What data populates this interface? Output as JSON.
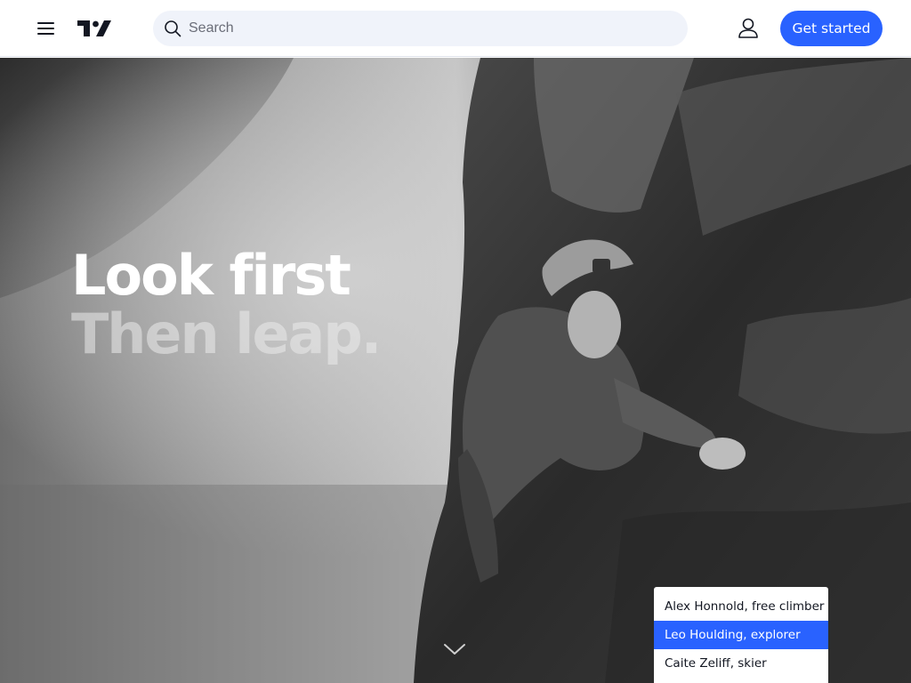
{
  "header": {
    "menu_icon": "hamburger-menu-icon",
    "logo_icon": "tradingview-logo-icon",
    "search": {
      "placeholder": "Search",
      "value": "",
      "icon": "search-icon"
    },
    "user_icon": "user-icon",
    "cta_label": "Get started"
  },
  "hero": {
    "headline_line1": "Look first",
    "headline_line2": "Then leap.",
    "scroll_icon": "chevron-down-icon"
  },
  "credits": {
    "items": [
      {
        "label": "Alex Honnold, free climber"
      },
      {
        "label": "Leo Houlding, explorer"
      },
      {
        "label": "Caite Zeliff, skier"
      }
    ],
    "selected_index": 1
  },
  "colors": {
    "accent": "#2962ff",
    "text": "#131722",
    "search_bg": "#f0f3fa"
  }
}
